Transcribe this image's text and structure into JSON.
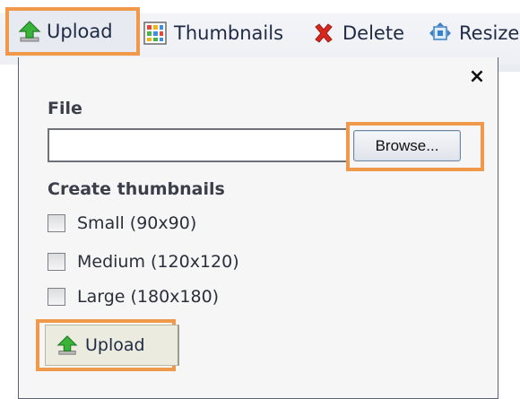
{
  "toolbar": {
    "upload_label": "Upload",
    "thumbnails_label": "Thumbnails",
    "delete_label": "Delete",
    "resize_label": "Resize"
  },
  "dialog": {
    "close_glyph": "×",
    "file_label": "File",
    "file_value": "",
    "browse_label": "Browse...",
    "thumbnails_heading": "Create thumbnails",
    "options": [
      {
        "label": "Small (90x90)",
        "checked": false
      },
      {
        "label": "Medium (120x120)",
        "checked": false
      },
      {
        "label": "Large (180x180)",
        "checked": false
      }
    ],
    "submit_label": "Upload"
  },
  "colors": {
    "highlight": "#f0994b",
    "upload_icon": "#2fa02a",
    "delete_icon": "#d8281e"
  },
  "icons": {
    "upload": "upload-arrow-icon",
    "thumbnails": "grid-icon",
    "delete": "x-mark-icon",
    "resize": "resize-icon"
  }
}
